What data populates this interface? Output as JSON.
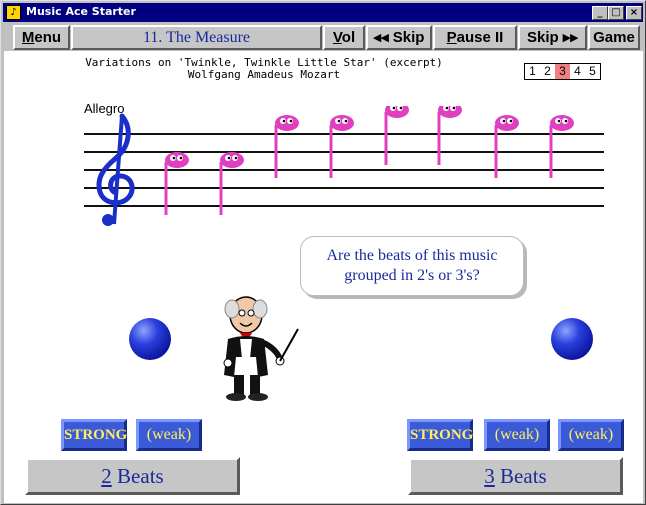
{
  "window": {
    "title": "Music Ace Starter",
    "controls": {
      "minimize": "_",
      "maximize": "□",
      "close": "×"
    }
  },
  "toolbar": {
    "menu": {
      "key": "M",
      "rest": "enu"
    },
    "lesson": "11. The Measure",
    "vol": {
      "key": "V",
      "rest": "ol"
    },
    "skip_back": "◂◂ Skip",
    "pause": {
      "key": "P",
      "rest": "ause",
      "suffix": " II"
    },
    "skip_forward": "Skip ▸▸",
    "game": "Game"
  },
  "piece": {
    "title_line1": "Variations on 'Twinkle, Twinkle Little Star' (excerpt)",
    "title_line2": "Wolfgang Amadeus Mozart",
    "tempo": "Allegro"
  },
  "steps": {
    "items": [
      "1",
      "2",
      "3",
      "4",
      "5"
    ],
    "active_index": 2
  },
  "staff": {
    "clef": "treble",
    "note_count": 8,
    "note_color": "#e040c0"
  },
  "question": {
    "line1": "Are the beats of this music",
    "line2": "grouped in 2's or 3's?"
  },
  "beats_left": [
    "STRONG",
    "(weak)"
  ],
  "beats_right": [
    "STRONG",
    "(weak)",
    "(weak)"
  ],
  "answers": {
    "two": {
      "key": "2",
      "rest": " Beats"
    },
    "three": {
      "key": "3",
      "rest": " Beats"
    }
  },
  "colors": {
    "title_bar": "#000080",
    "lesson_text": "#1a2a9a",
    "beat_button": "#3a5ad8",
    "beat_text": "#ffef5a",
    "ball": "#2a3fdc",
    "active_step": "#f08080"
  },
  "icons": {
    "app": "music-note-app-icon",
    "clef": "treble-clef-icon",
    "character": "conductor-character"
  }
}
